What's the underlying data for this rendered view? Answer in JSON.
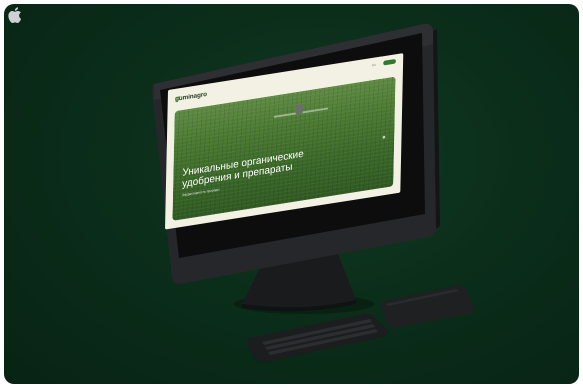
{
  "site": {
    "logo_text": "guminagro",
    "lang_label": "RU",
    "hero_title": "Уникальные органические удобрения и препараты",
    "hero_subtitle": "Эффективность природы"
  },
  "colors": {
    "background": "#0b2e1b",
    "screen_bg": "#f3f1e3",
    "brand_green": "#2f7a2f",
    "device_dark": "#1f2022"
  }
}
